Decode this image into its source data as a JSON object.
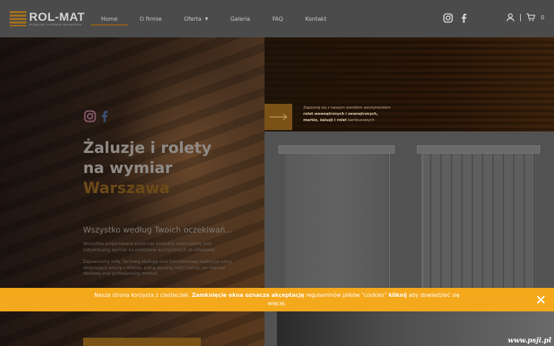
{
  "brand": {
    "name": "ROL-MAT",
    "tagline": "PRODUCENT SYSTEMÓW OSŁONOWYCH"
  },
  "nav": {
    "items": [
      {
        "label": "Home"
      },
      {
        "label": "O firmie"
      },
      {
        "label": "Oferta"
      },
      {
        "label": "Galeria"
      },
      {
        "label": "FAQ"
      },
      {
        "label": "Kontakt"
      }
    ]
  },
  "cart": {
    "count": "0"
  },
  "hero": {
    "title_line1": "Żaluzje i rolety",
    "title_line2": "na wymiar",
    "city": "Warszawa",
    "subtitle": "Wszystko według Twoich oczekiwań...",
    "p1": "Wszystkie proponowane przez nas produkty wykonujemy pod indywidualny wymiar na podstawie wyczynionych ze składowej.",
    "p2": "Zapewniamy miłą, fachową obsługę oraz kompleksową realizację usług obejmującą wizytę u klienta, pełną wycenę rolet i żaluzji jak również dostawę oraz profesjonalny montaż."
  },
  "promo": {
    "before": "Zapoznaj się z naszym szerokim asortymentem ",
    "bold": "rolet wewnętrznych i zewnętrznych, markiz, żaluzji i rolet",
    "after": " bambusowych"
  },
  "cookie": {
    "t1": "Nasza strona korzysta z ciasteczek. ",
    "b1": "Zamknięcie okna oznacza akceptację",
    "t2": " regulaminów plików \"cookies\" ",
    "b2": "kliknij",
    "t3": " aby dowiedzieć się więcej."
  },
  "watermark": "www.psji.pl",
  "colors": {
    "accent": "#f4a81c",
    "brand_dark": "#7a5218",
    "header_bg": "#4b4b4b"
  }
}
